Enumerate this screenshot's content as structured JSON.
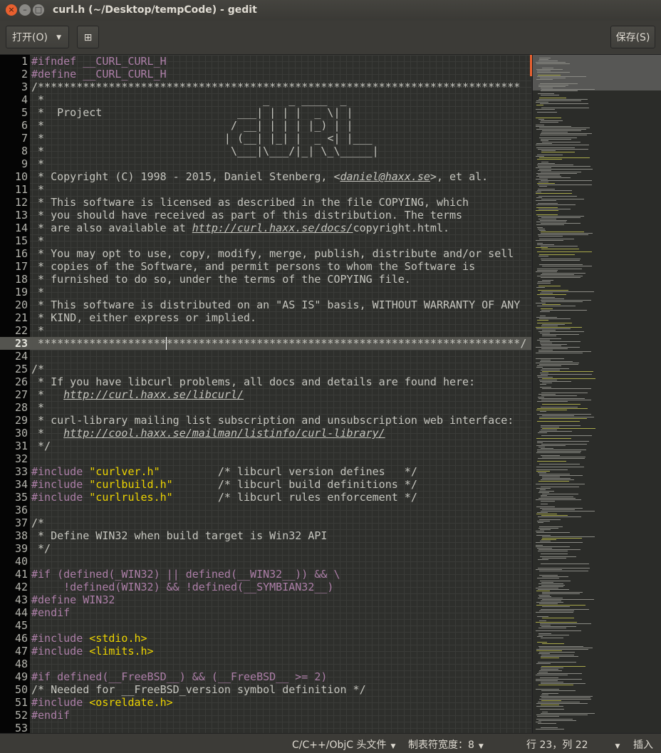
{
  "window": {
    "title": "curl.h (~/Desktop/tempCode) - gedit",
    "close_glyph": "×",
    "min_glyph": "–",
    "max_glyph": "□"
  },
  "toolbar": {
    "open_label": "打开(O)",
    "open_caret": "▼",
    "new_doc_glyph": "⊞",
    "save_label": "保存(S)"
  },
  "editor": {
    "current_line": 23,
    "lines": [
      [
        [
          "pp",
          "#ifndef __CURL_CURL_H"
        ]
      ],
      [
        [
          "pp",
          "#define __CURL_CURL_H"
        ]
      ],
      [
        [
          "cm",
          "/***************************************************************************"
        ]
      ],
      [
        [
          "cm",
          " *                                  _   _ ____  _"
        ]
      ],
      [
        [
          "cm",
          " *  Project                     ___| | | |  _ \\| |"
        ]
      ],
      [
        [
          "cm",
          " *                             / __| | | | |_) | |"
        ]
      ],
      [
        [
          "cm",
          " *                            | (__| |_| |  _ <| |___"
        ]
      ],
      [
        [
          "cm",
          " *                             \\___|\\___/|_| \\_\\_____|"
        ]
      ],
      [
        [
          "cm",
          " *"
        ]
      ],
      [
        [
          "cm",
          " * Copyright (C) 1998 - 2015, Daniel Stenberg, <"
        ],
        [
          "cm lk",
          "daniel@haxx.se"
        ],
        [
          "cm",
          ">, et al."
        ]
      ],
      [
        [
          "cm",
          " *"
        ]
      ],
      [
        [
          "cm",
          " * This software is licensed as described in the file COPYING, which"
        ]
      ],
      [
        [
          "cm",
          " * you should have received as part of this distribution. The terms"
        ]
      ],
      [
        [
          "cm",
          " * are also available at "
        ],
        [
          "cm lk",
          "http://curl.haxx.se/docs/"
        ],
        [
          "cm",
          "copyright.html."
        ]
      ],
      [
        [
          "cm",
          " *"
        ]
      ],
      [
        [
          "cm",
          " * You may opt to use, copy, modify, merge, publish, distribute and/or sell"
        ]
      ],
      [
        [
          "cm",
          " * copies of the Software, and permit persons to whom the Software is"
        ]
      ],
      [
        [
          "cm",
          " * furnished to do so, under the terms of the COPYING file."
        ]
      ],
      [
        [
          "cm",
          " *"
        ]
      ],
      [
        [
          "cm",
          " * This software is distributed on an \"AS IS\" basis, WITHOUT WARRANTY OF ANY"
        ]
      ],
      [
        [
          "cm",
          " * KIND, either express or implied."
        ]
      ],
      [
        [
          "cm",
          " *"
        ]
      ],
      [
        [
          "cm",
          " ***************************************************************************/"
        ]
      ],
      [
        [
          "cm",
          ""
        ]
      ],
      [
        [
          "cm",
          "/*"
        ]
      ],
      [
        [
          "cm",
          " * If you have libcurl problems, all docs and details are found here:"
        ]
      ],
      [
        [
          "cm",
          " *   "
        ],
        [
          "cm lk",
          "http://curl.haxx.se/libcurl/"
        ]
      ],
      [
        [
          "cm",
          " *"
        ]
      ],
      [
        [
          "cm",
          " * curl-library mailing list subscription and unsubscription web interface:"
        ]
      ],
      [
        [
          "cm",
          " *   "
        ],
        [
          "cm lk",
          "http://cool.haxx.se/mailman/listinfo/curl-library/"
        ]
      ],
      [
        [
          "cm",
          " */"
        ]
      ],
      [
        [
          "cm",
          ""
        ]
      ],
      [
        [
          "pp",
          "#include "
        ],
        [
          "st",
          "\"curlver.h\""
        ],
        [
          "cm",
          "         /* libcurl version defines   */"
        ]
      ],
      [
        [
          "pp",
          "#include "
        ],
        [
          "st",
          "\"curlbuild.h\""
        ],
        [
          "cm",
          "       /* libcurl build definitions */"
        ]
      ],
      [
        [
          "pp",
          "#include "
        ],
        [
          "st",
          "\"curlrules.h\""
        ],
        [
          "cm",
          "       /* libcurl rules enforcement */"
        ]
      ],
      [
        [
          "cm",
          ""
        ]
      ],
      [
        [
          "cm",
          "/*"
        ]
      ],
      [
        [
          "cm",
          " * Define WIN32 when build target is Win32 API"
        ]
      ],
      [
        [
          "cm",
          " */"
        ]
      ],
      [
        [
          "cm",
          ""
        ]
      ],
      [
        [
          "pp",
          "#if (defined(_WIN32) || defined(__WIN32__)) && \\"
        ]
      ],
      [
        [
          "pp",
          "     !defined(WIN32) && !defined(__SYMBIAN32__)"
        ]
      ],
      [
        [
          "pp",
          "#define WIN32"
        ]
      ],
      [
        [
          "pp",
          "#endif"
        ]
      ],
      [
        [
          "cm",
          ""
        ]
      ],
      [
        [
          "pp",
          "#include "
        ],
        [
          "st",
          "<stdio.h>"
        ]
      ],
      [
        [
          "pp",
          "#include "
        ],
        [
          "st",
          "<limits.h>"
        ]
      ],
      [
        [
          "cm",
          ""
        ]
      ],
      [
        [
          "pp",
          "#if defined(__FreeBSD__) && (__FreeBSD__ >= 2)"
        ]
      ],
      [
        [
          "cm",
          "/* Needed for __FreeBSD_version symbol definition */"
        ]
      ],
      [
        [
          "pp",
          "#include "
        ],
        [
          "st",
          "<osreldate.h>"
        ]
      ],
      [
        [
          "pp",
          "#endif"
        ]
      ],
      [
        [
          "cm",
          ""
        ]
      ]
    ]
  },
  "statusbar": {
    "language": "C/C++/ObjC 头文件",
    "tab_width": "制表符宽度：8",
    "position": "行 23，列 22",
    "mode": "插入",
    "caret": "▼"
  }
}
